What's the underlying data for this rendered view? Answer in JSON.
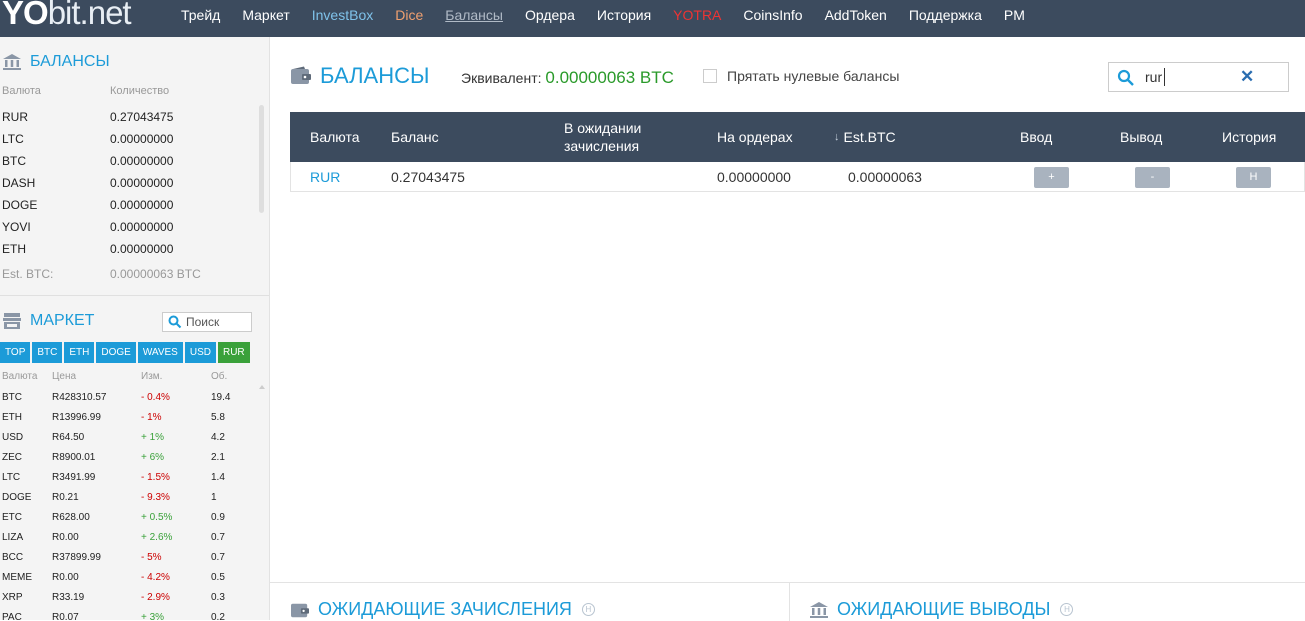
{
  "logo": {
    "yo": "YO",
    "bit": "bit",
    "dot": ".",
    "net": "net"
  },
  "nav": [
    {
      "label": "Трейд",
      "cls": ""
    },
    {
      "label": "Маркет",
      "cls": ""
    },
    {
      "label": "InvestBox",
      "cls": "c-invest"
    },
    {
      "label": "Dice",
      "cls": "c-dice"
    },
    {
      "label": "Балансы",
      "cls": "c-bal"
    },
    {
      "label": "Ордера",
      "cls": ""
    },
    {
      "label": "История",
      "cls": ""
    },
    {
      "label": "YOTRA",
      "cls": "c-yotra"
    },
    {
      "label": "CoinsInfo",
      "cls": ""
    },
    {
      "label": "AddToken",
      "cls": ""
    },
    {
      "label": "Поддержка",
      "cls": ""
    },
    {
      "label": "PM",
      "cls": ""
    }
  ],
  "sidebar": {
    "balances_title": "БАЛАНСЫ",
    "col_currency": "Валюта",
    "col_amount": "Количество",
    "balances": [
      {
        "cur": "RUR",
        "amt": "0.27043475"
      },
      {
        "cur": "LTC",
        "amt": "0.00000000"
      },
      {
        "cur": "BTC",
        "amt": "0.00000000"
      },
      {
        "cur": "DASH",
        "amt": "0.00000000"
      },
      {
        "cur": "DOGE",
        "amt": "0.00000000"
      },
      {
        "cur": "YOVI",
        "amt": "0.00000000"
      },
      {
        "cur": "ETH",
        "amt": "0.00000000"
      }
    ],
    "est_label": "Est. BTC:",
    "est_value": "0.00000063 BTC",
    "market_title": "МАРКЕТ",
    "market_search_placeholder": "Поиск",
    "market_tabs": [
      "TOP",
      "BTC",
      "ETH",
      "DOGE",
      "WAVES",
      "USD",
      "RUR"
    ],
    "market_active_tab": "RUR",
    "market_cols": {
      "cur": "Валюта",
      "price": "Цена",
      "change": "Изм.",
      "vol": "Об."
    },
    "market_rows": [
      {
        "cur": "BTC",
        "price": "R428310.57",
        "change": "- 0.4%",
        "dir": "neg",
        "vol": "19.4"
      },
      {
        "cur": "ETH",
        "price": "R13996.99",
        "change": "- 1%",
        "dir": "neg",
        "vol": "5.8"
      },
      {
        "cur": "USD",
        "price": "R64.50",
        "change": "+ 1%",
        "dir": "pos",
        "vol": "4.2"
      },
      {
        "cur": "ZEC",
        "price": "R8900.01",
        "change": "+ 6%",
        "dir": "pos",
        "vol": "2.1"
      },
      {
        "cur": "LTC",
        "price": "R3491.99",
        "change": "- 1.5%",
        "dir": "neg",
        "vol": "1.4"
      },
      {
        "cur": "DOGE",
        "price": "R0.21",
        "change": "- 9.3%",
        "dir": "neg",
        "vol": "1"
      },
      {
        "cur": "ETC",
        "price": "R628.00",
        "change": "+ 0.5%",
        "dir": "pos",
        "vol": "0.9"
      },
      {
        "cur": "LIZA",
        "price": "R0.00",
        "change": "+ 2.6%",
        "dir": "pos",
        "vol": "0.7"
      },
      {
        "cur": "BCC",
        "price": "R37899.99",
        "change": "- 5%",
        "dir": "neg",
        "vol": "0.7"
      },
      {
        "cur": "MEME",
        "price": "R0.00",
        "change": "- 4.2%",
        "dir": "neg",
        "vol": "0.5"
      },
      {
        "cur": "XRP",
        "price": "R33.19",
        "change": "- 2.9%",
        "dir": "neg",
        "vol": "0.3"
      },
      {
        "cur": "PAC",
        "price": "R0.07",
        "change": "+ 3%",
        "dir": "pos",
        "vol": "0.2"
      }
    ]
  },
  "main": {
    "title": "БАЛАНСЫ",
    "equiv_label": "Эквивалент:",
    "equiv_value": "0.00000063 BTC",
    "hide_zero_label": "Прятать нулевые балансы",
    "search_value": "rur",
    "table_headers": {
      "currency": "Валюта",
      "balance": "Баланс",
      "pending_1": "В ожидании",
      "pending_2": "зачисления",
      "on_orders": "На ордерах",
      "est_btc": "Est.BTC",
      "deposit": "Ввод",
      "withdraw": "Вывод",
      "history": "История"
    },
    "row": {
      "currency": "RUR",
      "balance": "0.27043475",
      "pending": "",
      "on_orders": "0.00000000",
      "est_btc": "0.00000063",
      "deposit_btn": "+",
      "withdraw_btn": "-",
      "history_btn": "H"
    },
    "pending_deposits_title": "ОЖИДАЮЩИЕ ЗАЧИСЛЕНИЯ",
    "pending_withdrawals_title": "ОЖИДАЮЩИЕ ВЫВОДЫ",
    "help_glyph": "H"
  },
  "colors": {
    "accent": "#1c9bd8",
    "topbar": "#3c4b5e",
    "positive": "#3aa13a",
    "negative": "#cc0000"
  }
}
